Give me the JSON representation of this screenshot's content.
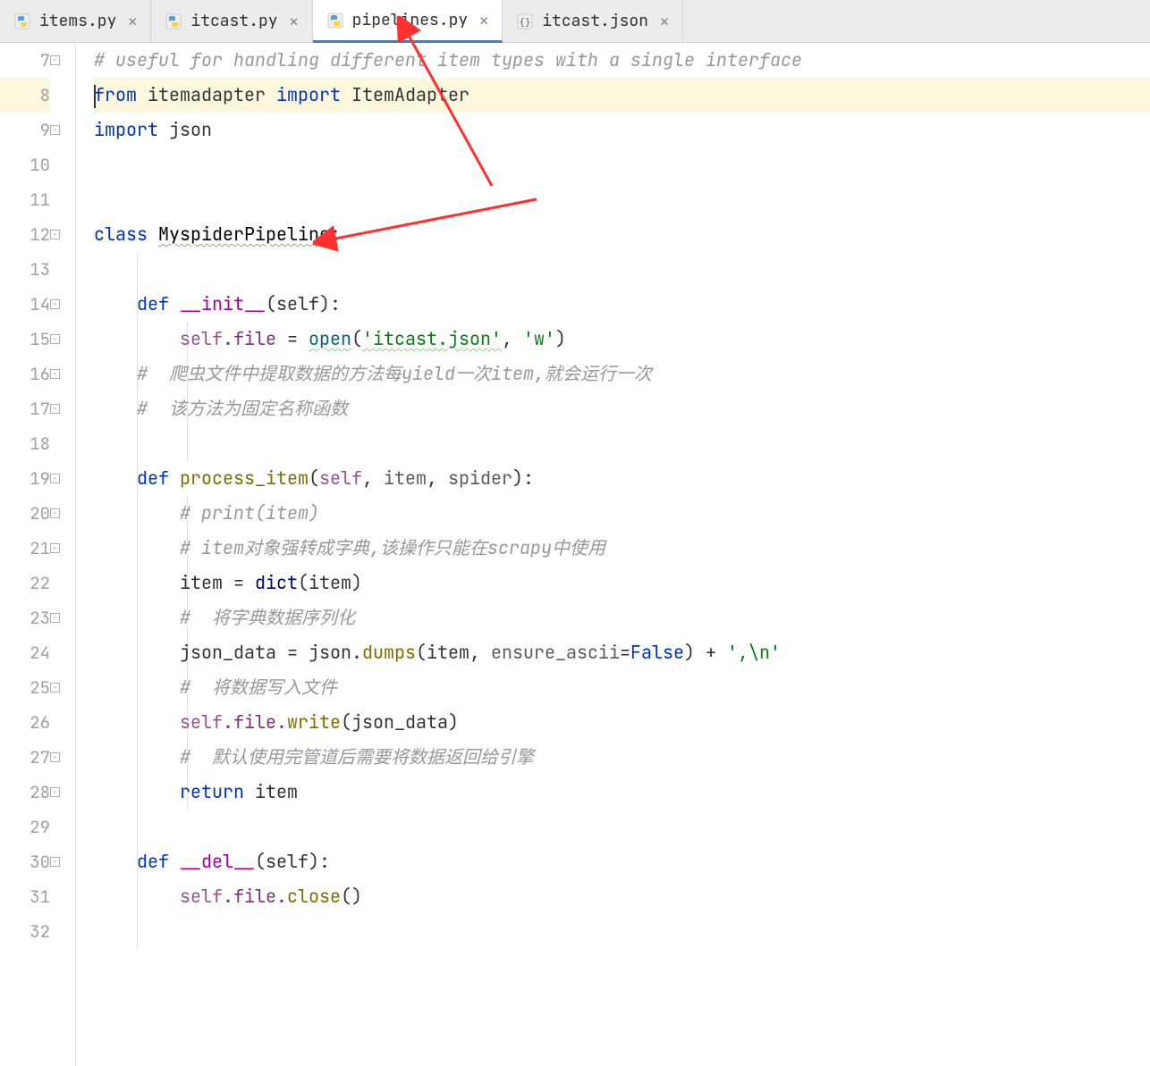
{
  "tabs": [
    {
      "label": "items.py",
      "type": "py",
      "active": false
    },
    {
      "label": "itcast.py",
      "type": "py",
      "active": false
    },
    {
      "label": "pipelines.py",
      "type": "py",
      "active": true
    },
    {
      "label": "itcast.json",
      "type": "json",
      "active": false
    }
  ],
  "gutter": {
    "start": 7,
    "end": 32
  },
  "code": {
    "l7_comment": "# useful for handling different item types with a single interface",
    "l8_from": "from",
    "l8_mod": "itemadapter",
    "l8_import": "import",
    "l8_name": "ItemAdapter",
    "l9_import": "import",
    "l9_mod": "json",
    "l12_class": "class",
    "l12_name": "MyspiderPipeline",
    "l12_colon": ":",
    "l14_def": "def",
    "l14_name": "__init__",
    "l14_params": "(self):",
    "l15_self": "self",
    "l15_dot_file": ".file",
    "l15_eq": " = ",
    "l15_open": "open",
    "l15_args": "(",
    "l15_str1": "'itcast.json'",
    "l15_comma": ", ",
    "l15_str2": "'w'",
    "l15_close": ")",
    "l16_comment": "#  爬虫文件中提取数据的方法每yield一次item,就会运行一次",
    "l17_comment": "#  该方法为固定名称函数",
    "l19_def": "def",
    "l19_name": "process_item",
    "l19_p_open": "(",
    "l19_self": "self",
    "l19_c1": ", ",
    "l19_item": "item",
    "l19_c2": ", ",
    "l19_spider": "spider",
    "l19_p_close": "):",
    "l20_comment": "# print(item)",
    "l21_comment": "# item对象强转成字典,该操作只能在scrapy中使用",
    "l22_item": "item",
    "l22_eq": " = ",
    "l22_dict": "dict",
    "l22_args": "(item)",
    "l23_comment": "#  将字典数据序列化",
    "l24_var": "json_data",
    "l24_eq": " = ",
    "l24_json": "json",
    "l24_dot": ".",
    "l24_dumps": "dumps",
    "l24_open": "(",
    "l24_item": "item",
    "l24_c": ", ",
    "l24_kw": "ensure_ascii",
    "l24_eqp": "=",
    "l24_false": "False",
    "l24_close": ") + ",
    "l24_str": "',\\n'",
    "l25_comment": "#  将数据写入文件",
    "l26_self": "self",
    "l26_file": ".file.",
    "l26_write": "write",
    "l26_args": "(json_data)",
    "l27_comment": "#  默认使用完管道后需要将数据返回给引擎",
    "l28_return": "return",
    "l28_item": "item",
    "l30_def": "def",
    "l30_name": "__del__",
    "l30_params": "(self):",
    "l31_self": "self",
    "l31_file": ".file.",
    "l31_close": "close",
    "l31_args": "()"
  }
}
